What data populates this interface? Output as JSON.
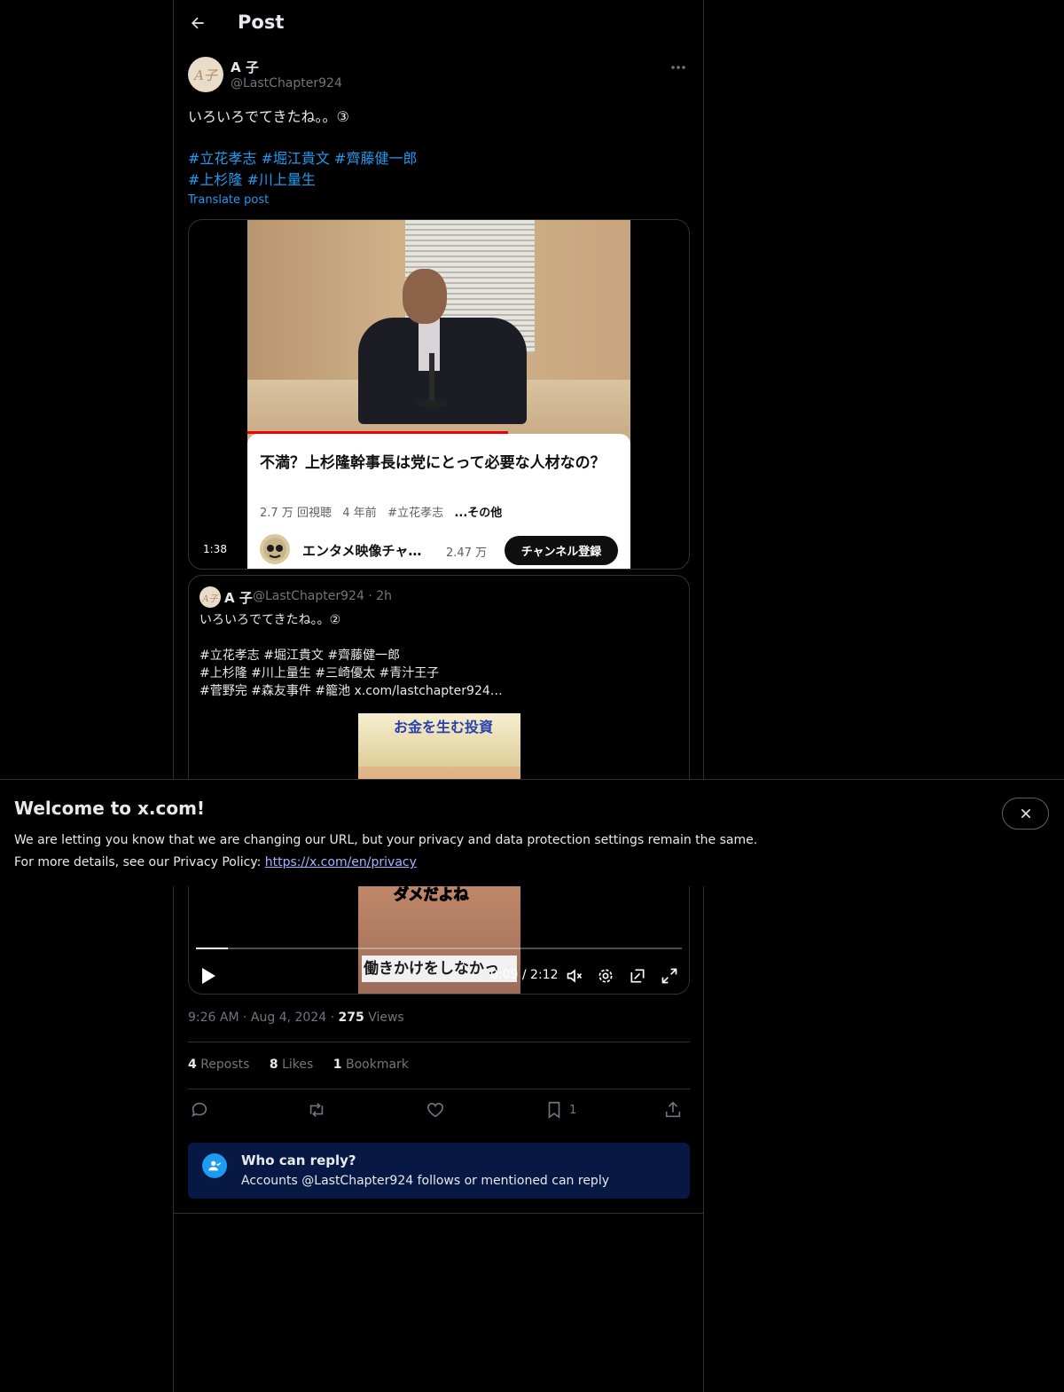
{
  "header": {
    "title": "Post"
  },
  "post": {
    "author_name": "A 子",
    "author_handle": "@LastChapter924",
    "avatar_text": "A子",
    "text": "いろいろでてきたね。。③",
    "hashtags_line1": [
      "#立花孝志",
      "#堀江貴文",
      "#齊藤健一郎"
    ],
    "hashtags_line2": [
      "#上杉隆",
      "#川上量生"
    ],
    "translate_label": "Translate post",
    "time": "9:26 AM",
    "date": "Aug 4, 2024",
    "views_count": "275",
    "views_label": "Views",
    "reposts_count": "4",
    "reposts_label": "Reposts",
    "likes_count": "8",
    "likes_label": "Likes",
    "bookmarks_count": "1",
    "bookmarks_label": "Bookmark",
    "bookmark_action_count": "1"
  },
  "youtube_card": {
    "title": "不満？上杉隆幹事長は党にとって必要な人材なの？",
    "views": "2.7 万 回視聴",
    "age": "4 年前",
    "tag": "#立花孝志",
    "more": "...その他",
    "channel_name": "エンタメ映像チャ…",
    "subscribers": "2.47 万",
    "subscribe_label": "チャンネル登録",
    "duration": "1:38",
    "watched_fraction": 0.68
  },
  "quoted_post": {
    "author_name": "A 子",
    "author_handle": "@LastChapter924",
    "age": "2h",
    "text": "いろいろでてきたね。。②\n\n#立花孝志 #堀江貴文 #齊藤健一郎\n#上杉隆 #川上量生 #三崎優太 #青汁王子\n#菅野完 #森友事件 #籠池  x.com/lastchapter924…",
    "video_banner": "お金を生む投資",
    "video_caption_mid": "ダメだよね",
    "video_caption_bottom": "働きかけをしなかっ",
    "video_time": "0:09 / 2:12",
    "progress_fraction": 0.066
  },
  "reply_restriction": {
    "title": "Who can reply?",
    "subtitle": "Accounts @LastChapter924 follows or mentioned can reply"
  },
  "cookie_banner": {
    "title": "Welcome to x.com!",
    "line1": "We are letting you know that we are changing our URL, but your privacy and data protection settings remain the same.",
    "line2_prefix": "For more details, see our Privacy Policy: ",
    "link": "https://x.com/en/privacy"
  },
  "colors": {
    "background": "#000000",
    "accent": "#1d9bf0",
    "muted": "#71767b",
    "reply_box": "#071845"
  },
  "icons": [
    "back-arrow-icon",
    "more-icon",
    "reply-icon",
    "repost-icon",
    "like-icon",
    "bookmark-icon",
    "share-icon",
    "play-icon",
    "mute-icon",
    "settings-icon",
    "pip-icon",
    "fullscreen-icon",
    "close-icon",
    "person-check-icon"
  ]
}
